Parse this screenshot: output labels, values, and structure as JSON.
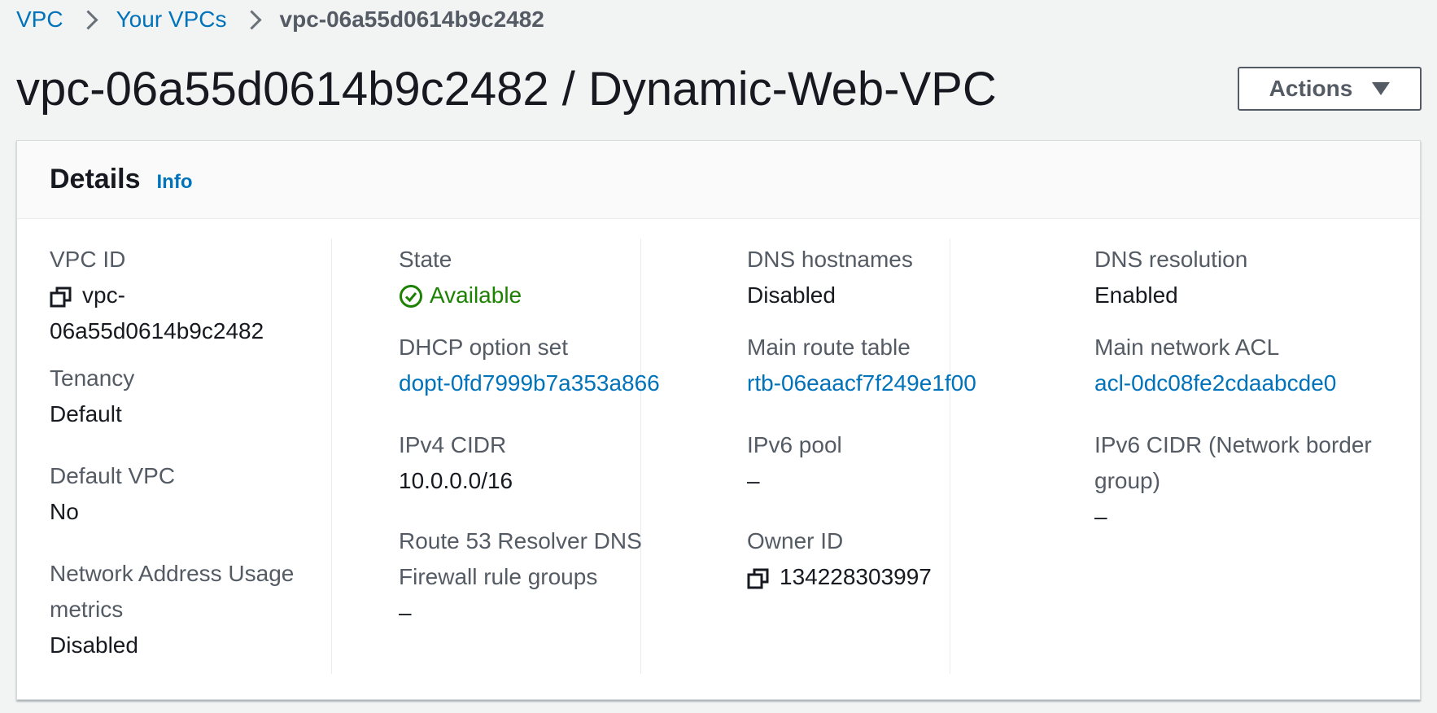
{
  "breadcrumb": {
    "items": [
      {
        "label": "VPC"
      },
      {
        "label": "Your VPCs"
      }
    ],
    "current": "vpc-06a55d0614b9c2482"
  },
  "page": {
    "title": "vpc-06a55d0614b9c2482 / Dynamic-Web-VPC",
    "actions_label": "Actions"
  },
  "details": {
    "title": "Details",
    "info_label": "Info",
    "vpc_id": {
      "label": "VPC ID",
      "value_line1": "vpc-",
      "value_line2": "06a55d0614b9c2482"
    },
    "tenancy": {
      "label": "Tenancy",
      "value": "Default"
    },
    "default_vpc": {
      "label": "Default VPC",
      "value": "No"
    },
    "nau_metrics": {
      "label_line1": "Network Address Usage",
      "label_line2": "metrics",
      "value": "Disabled"
    },
    "state": {
      "label": "State",
      "value": "Available"
    },
    "dhcp": {
      "label": "DHCP option set",
      "value": "dopt-0fd7999b7a353a866"
    },
    "ipv4_cidr": {
      "label": "IPv4 CIDR",
      "value": "10.0.0.0/16"
    },
    "route53": {
      "label_line1": "Route 53 Resolver DNS",
      "label_line2": "Firewall rule groups",
      "value": "–"
    },
    "dns_hostnames": {
      "label": "DNS hostnames",
      "value": "Disabled"
    },
    "main_route_table": {
      "label": "Main route table",
      "value": "rtb-06eaacf7f249e1f00"
    },
    "ipv6_pool": {
      "label": "IPv6 pool",
      "value": "–"
    },
    "owner_id": {
      "label": "Owner ID",
      "value": "134228303997"
    },
    "dns_resolution": {
      "label": "DNS resolution",
      "value": "Enabled"
    },
    "main_network_acl": {
      "label": "Main network ACL",
      "value": "acl-0dc08fe2cdaabcde0"
    },
    "ipv6_cidr": {
      "label_line1": "IPv6 CIDR (Network border",
      "label_line2": "group)",
      "value": "–"
    }
  },
  "colors": {
    "link": "#0073bb",
    "success": "#1d8102",
    "label": "#545b64",
    "text": "#16191f"
  },
  "icons": [
    "chevron-right-icon",
    "caret-down-icon",
    "copy-icon",
    "status-check-icon"
  ]
}
